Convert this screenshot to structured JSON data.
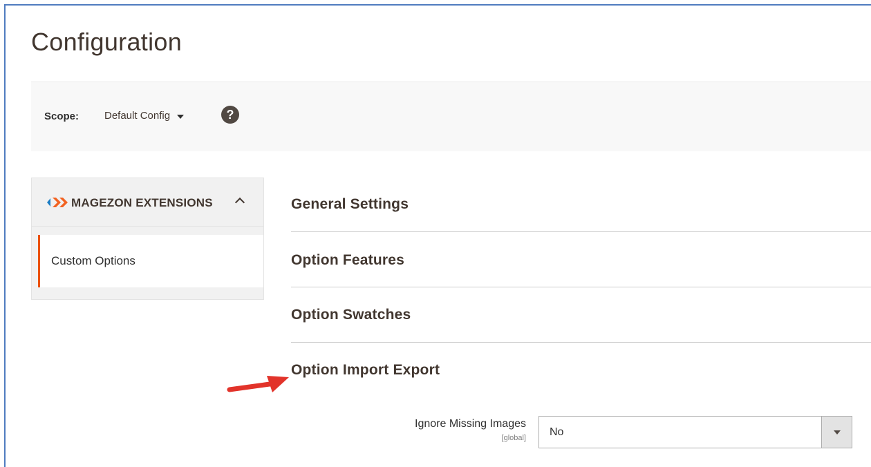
{
  "page": {
    "title": "Configuration"
  },
  "scope": {
    "label": "Scope:",
    "value": "Default Config",
    "help_glyph": "?"
  },
  "sidebar": {
    "title": "MAGEZON EXTENSIONS",
    "items": [
      {
        "label": "Custom Options",
        "active": true
      }
    ]
  },
  "sections": [
    {
      "title": "General Settings"
    },
    {
      "title": "Option Features"
    },
    {
      "title": "Option Swatches"
    },
    {
      "title": "Option Import Export"
    }
  ],
  "field": {
    "label": "Ignore Missing Images",
    "scope": "[global]",
    "value": "No"
  },
  "colors": {
    "accent": "#eb5202",
    "frame": "#4f7cbf",
    "arrow": "#e2332a",
    "logo_blue": "#1a7dc4",
    "logo_orange": "#f26322"
  },
  "icons": [
    "magezon-logo-icon",
    "help-icon",
    "chevron-up-icon",
    "chevron-down-icon",
    "red-arrow-icon"
  ]
}
